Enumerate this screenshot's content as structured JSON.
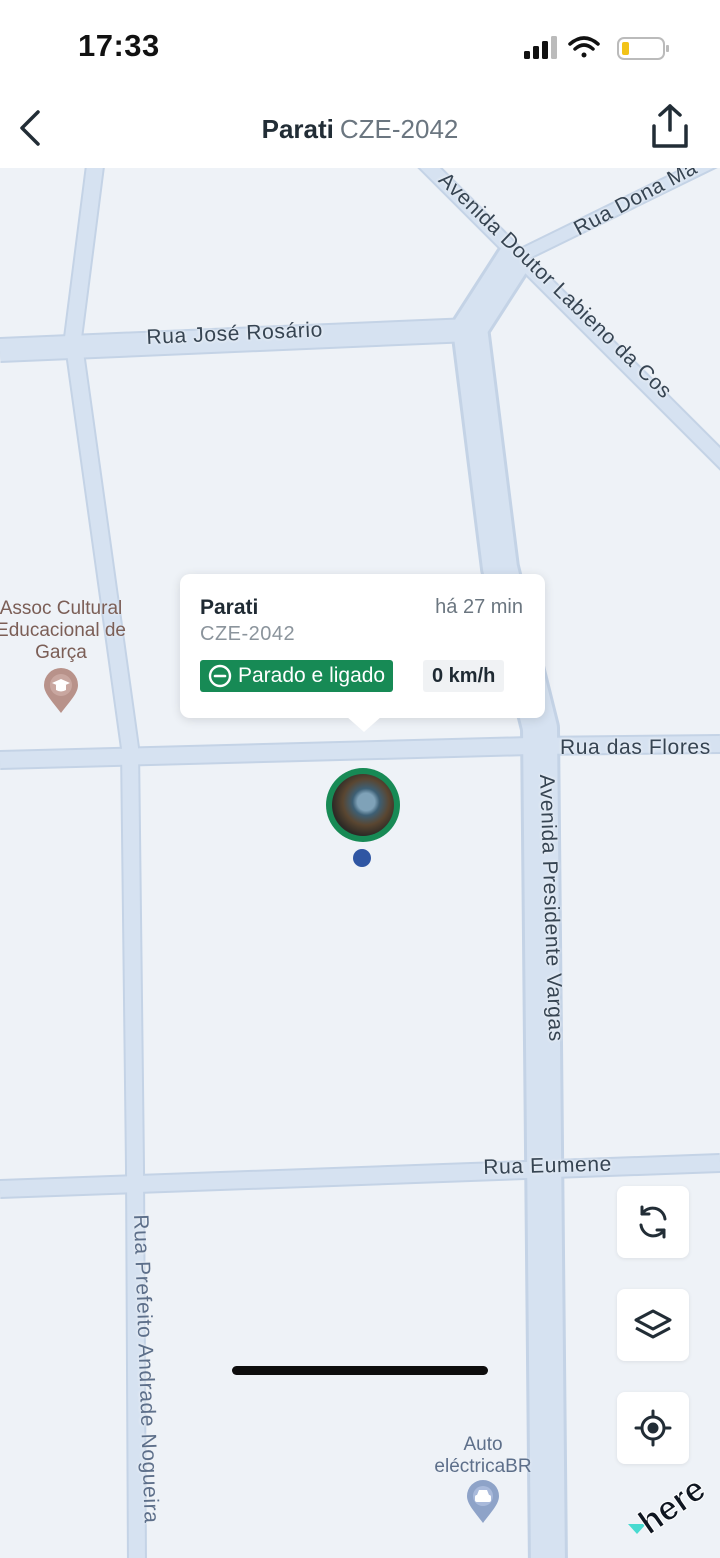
{
  "status_bar": {
    "time": "17:33"
  },
  "header": {
    "vehicle_name": "Parati",
    "plate": "CZE-2042"
  },
  "map": {
    "streets": {
      "rua_jose_rosario": "Rua José Rosário",
      "avenida_doutor_labieno": "Avenida Doutor Labieno da Cos",
      "rua_dona": "Rua Dona Ma",
      "rua_das_flores": "Rua das Flores",
      "avenida_presidente_vargas": "Avenida Presidente Vargas",
      "rua_eumene": "Rua Eumene",
      "rua_prefeito": "Rua Prefeito Andrade Nogueira"
    },
    "pois": {
      "assoc_line1": "Assoc Cultural",
      "assoc_line2": "Educacional de",
      "assoc_line3": "Garça",
      "auto_line1": "Auto",
      "auto_line2": "eléctricaBR"
    },
    "attribution": "here"
  },
  "popup": {
    "name": "Parati",
    "plate": "CZE-2042",
    "time_ago": "há 27 min",
    "status": "Parado e ligado",
    "speed": "0 km/h"
  },
  "colors": {
    "status_green": "#178a55",
    "road": "#d5e1f0",
    "map_bg": "#eef2f7",
    "location_dot": "#2f56a3"
  },
  "icons": {
    "back": "chevron-left-icon",
    "share": "share-icon",
    "refresh": "refresh-icon",
    "layers": "layers-icon",
    "locate": "crosshair-icon",
    "status": "minus-circle-icon"
  }
}
